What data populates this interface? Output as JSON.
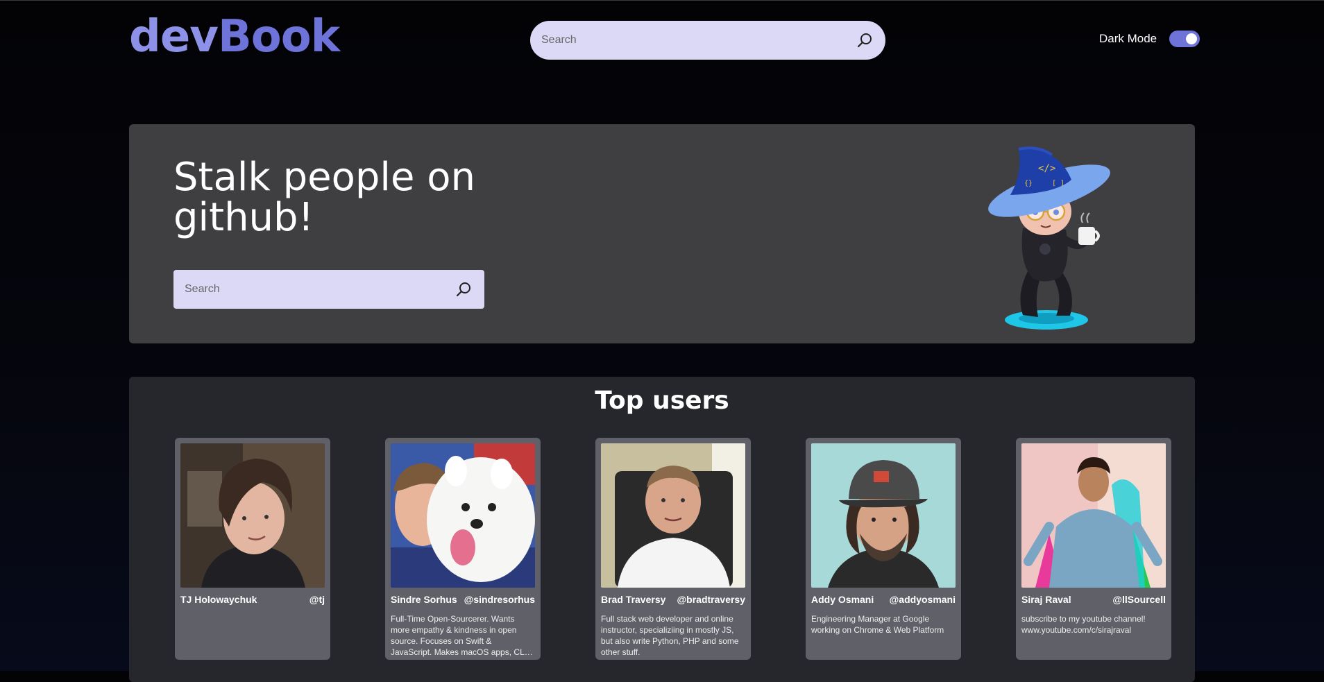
{
  "header": {
    "logo_part1": "dev",
    "logo_part2": "Book",
    "search_placeholder": "Search",
    "darkmode_label": "Dark Mode",
    "darkmode_on": true
  },
  "hero": {
    "title": "Stalk people on github!",
    "search_placeholder": "Search"
  },
  "top_users": {
    "title": "Top users",
    "users": [
      {
        "name": "TJ Holowaychuk",
        "handle": "@tj",
        "bio": ""
      },
      {
        "name": "Sindre Sorhus",
        "handle": "@sindresorhus",
        "bio": "Full-Time Open-Sourcerer. Wants more empathy & kindness in open source. Focuses on Swift & JavaScript. Makes macOS apps, CLI tools, npm packages."
      },
      {
        "name": "Brad Traversy",
        "handle": "@bradtraversy",
        "bio": "Full stack web developer and online instructor, specializiing in mostly JS, but also write Python, PHP and some other stuff."
      },
      {
        "name": "Addy Osmani",
        "handle": "@addyosmani",
        "bio": "Engineering Manager at Google working on Chrome & Web Platform"
      },
      {
        "name": "Siraj Raval",
        "handle": "@llSourcell",
        "bio": "subscribe to my youtube channel! www.youtube.com/c/sirajraval"
      }
    ]
  },
  "colors": {
    "accent": "#6d73d9",
    "search_bg": "#dcd9f7",
    "hero_bg": "#3f3f42",
    "card_bg": "#5f6068"
  }
}
